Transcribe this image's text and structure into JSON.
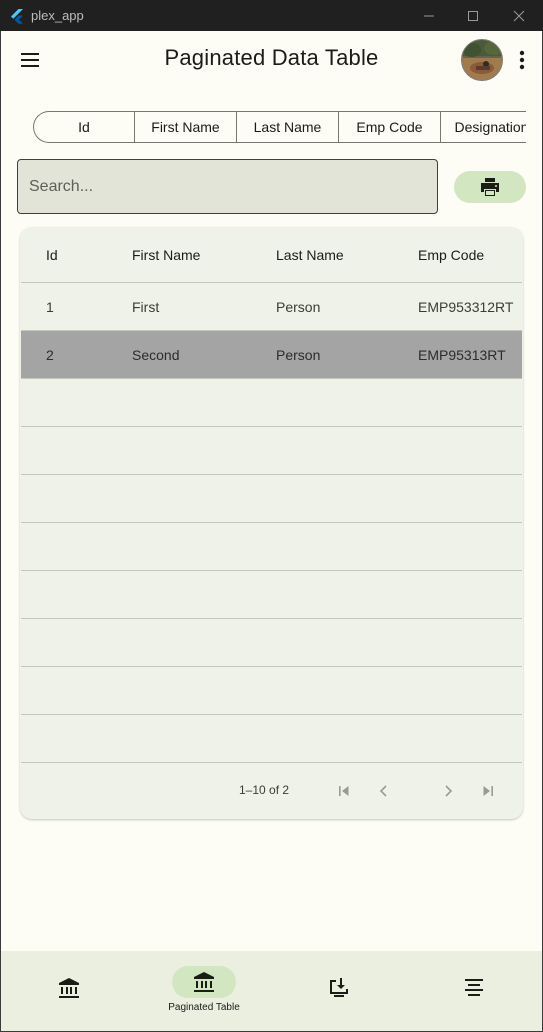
{
  "window": {
    "title": "plex_app",
    "icons": {
      "app": "flutter-logo-icon",
      "minimize": "minimize-icon",
      "maximize": "maximize-icon",
      "close": "close-icon"
    }
  },
  "appbar": {
    "title": "Paginated Data Table",
    "menu_icon": "hamburger-menu-icon",
    "avatar": "user-avatar",
    "more_icon": "more-vertical-icon"
  },
  "column_selector": {
    "segments": [
      "Id",
      "First Name",
      "Last Name",
      "Emp Code",
      "Designation"
    ]
  },
  "search": {
    "placeholder": "Search..."
  },
  "print_button": {
    "icon": "printer-icon"
  },
  "table": {
    "columns": [
      "Id",
      "First Name",
      "Last Name",
      "Emp Code"
    ],
    "rows": [
      {
        "id": "1",
        "first_name": "First",
        "last_name": "Person",
        "emp_code": "EMP953312RT"
      },
      {
        "id": "2",
        "first_name": "Second",
        "last_name": "Person",
        "emp_code": "EMP95313RT"
      }
    ],
    "selected_row": 2,
    "empty_rows": 8,
    "pagination": {
      "range_text": "1–10 of 2",
      "icons": [
        "first-page-icon",
        "chevron-left-icon",
        "chevron-right-icon",
        "last-page-icon"
      ]
    }
  },
  "bottom_nav": {
    "items": [
      {
        "icon": "bank-icon",
        "label": ""
      },
      {
        "icon": "bank-icon",
        "label": "Paginated Table",
        "active": true
      },
      {
        "icon": "download-to-device-icon",
        "label": ""
      },
      {
        "icon": "align-center-icon",
        "label": ""
      }
    ]
  },
  "colors": {
    "background": "#fdfdf5",
    "accent_container": "#d3e6c2",
    "table_surface": "#eff2e8",
    "selected_row": "#a4a4a4",
    "titlebar": "#202020"
  }
}
